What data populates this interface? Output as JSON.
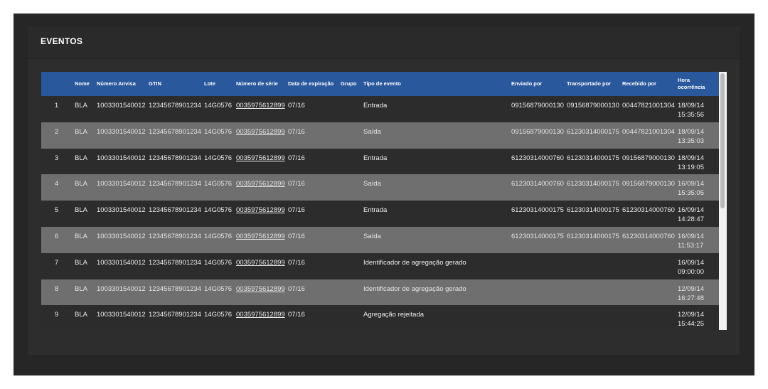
{
  "panel": {
    "title": "EVENTOS"
  },
  "table": {
    "columns": [
      "",
      "Nome",
      "Número Anvisa",
      "GTIN",
      "Lote",
      "Número de série",
      "Data de expiração",
      "Grupo",
      "Tipo de evento",
      "Enviado por",
      "Transportado por",
      "Recebido por",
      "Hora ocorrência"
    ],
    "rows": [
      [
        "1",
        "BLA",
        "1003301540012",
        "12345678901234",
        "14G0576",
        "0035975612899",
        "07/16",
        "",
        "Entrada",
        "09156879000130",
        "09156879000130",
        "00447821001304",
        "18/09/14 15:35:56"
      ],
      [
        "2",
        "BLA",
        "1003301540012",
        "12345678901234",
        "14G0576",
        "0035975612899",
        "07/16",
        "",
        "Saída",
        "09156879000130",
        "61230314000175",
        "00447821001304",
        "18/09/14 13:35:03"
      ],
      [
        "3",
        "BLA",
        "1003301540012",
        "12345678901234",
        "14G0576",
        "0035975612899",
        "07/16",
        "",
        "Entrada",
        "61230314000760",
        "61230314000175",
        "09156879000130",
        "18/09/14 13:19:05"
      ],
      [
        "4",
        "BLA",
        "1003301540012",
        "12345678901234",
        "14G0576",
        "0035975612899",
        "07/16",
        "",
        "Saída",
        "61230314000760",
        "61230314000175",
        "09156879000130",
        "16/09/14 15:35:05"
      ],
      [
        "5",
        "BLA",
        "1003301540012",
        "12345678901234",
        "14G0576",
        "0035975612899",
        "07/16",
        "",
        "Entrada",
        "61230314000175",
        "61230314000175",
        "61230314000760",
        "16/09/14 14:28:47"
      ],
      [
        "6",
        "BLA",
        "1003301540012",
        "12345678901234",
        "14G0576",
        "0035975612899",
        "07/16",
        "",
        "Saída",
        "61230314000175",
        "61230314000175",
        "61230314000760",
        "16/09/14 11:53:17"
      ],
      [
        "7",
        "BLA",
        "1003301540012",
        "12345678901234",
        "14G0576",
        "0035975612899",
        "07/16",
        "",
        "Identificador de agregação gerado",
        "",
        "",
        "",
        "16/09/14 09:00:00"
      ],
      [
        "8",
        "BLA",
        "1003301540012",
        "12345678901234",
        "14G0576",
        "0035975612899",
        "07/16",
        "",
        "Identificador de agregação gerado",
        "",
        "",
        "",
        "12/09/14 16:27:48"
      ],
      [
        "9",
        "BLA",
        "1003301540012",
        "12345678901234",
        "14G0576",
        "0035975612899",
        "07/16",
        "",
        "Agregação rejeitada",
        "",
        "",
        "",
        "12/09/14 15:44:25"
      ]
    ]
  },
  "colors": {
    "header_bg": "#2a589d",
    "row_dark": "#2c2c2d",
    "row_light": "#6f6f70",
    "panel_bg": "#2d2d2e",
    "screen_bg": "#262627"
  }
}
